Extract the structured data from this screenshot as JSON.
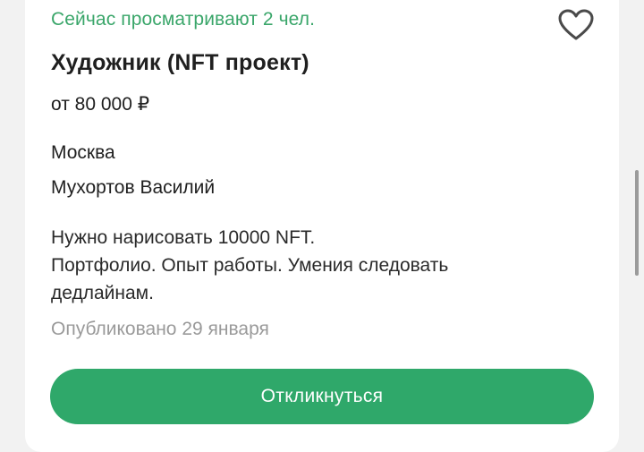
{
  "vacancy": {
    "viewers_text": "Сейчас просматривают 2 чел.",
    "title": "Художник (NFT проект)",
    "salary": "от 80 000 ₽",
    "city": "Москва",
    "employer": "Мухортов Василий",
    "description_lines": [
      "Нужно нарисовать 10000 NFT.",
      "Портфолио. Опыт работы. Умения следовать",
      "дедлайнам."
    ],
    "published": "Опубликовано 29 января",
    "respond_label": "Откликнуться",
    "favorite_icon": "heart-outline-icon"
  },
  "colors": {
    "accent_green": "#2fa86a",
    "viewers_green": "#3aa66a",
    "muted_gray": "#9a9a9a"
  }
}
